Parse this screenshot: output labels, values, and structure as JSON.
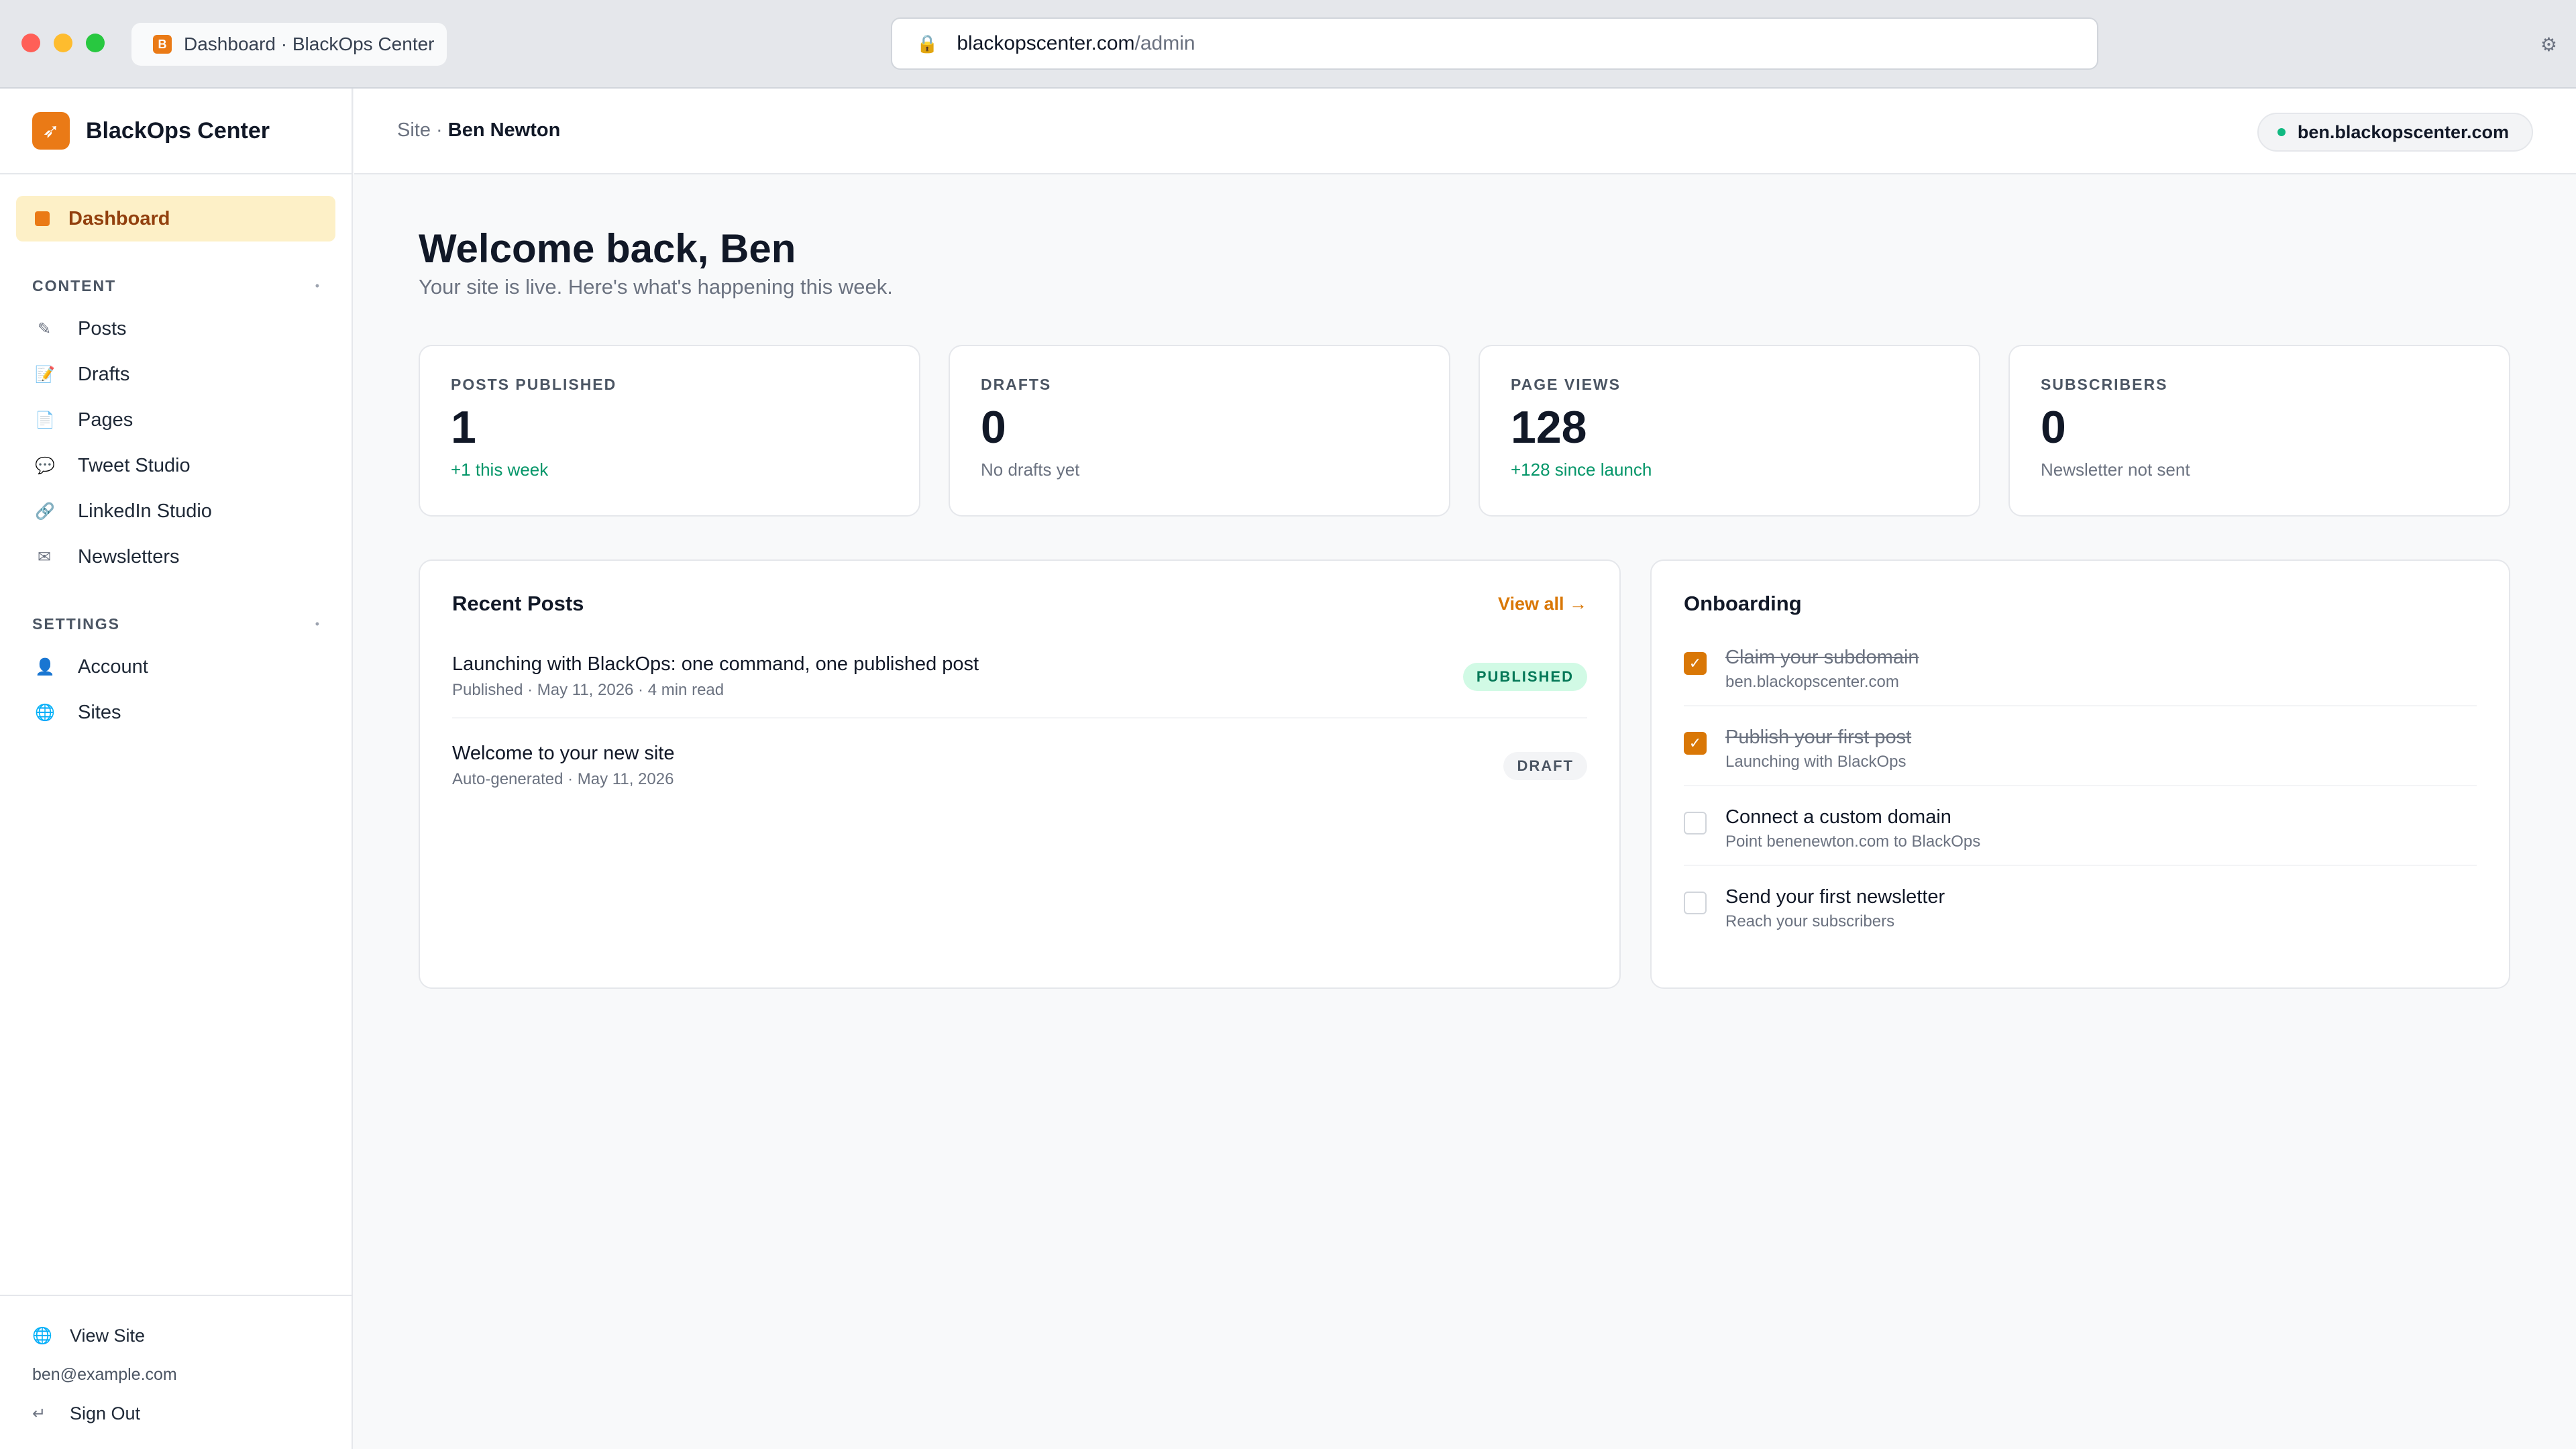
{
  "browser": {
    "tab_title": "Dashboard · BlackOps Center",
    "tab_favicon": "B",
    "url_host": "blackopscenter.com",
    "url_path": "/admin"
  },
  "sidebar": {
    "brand": "BlackOps Center",
    "active_item": "Dashboard",
    "sections": [
      {
        "title": "CONTENT",
        "items": [
          {
            "label": "Posts",
            "icon": "pencil-icon"
          },
          {
            "label": "Drafts",
            "icon": "memo-icon"
          },
          {
            "label": "Pages",
            "icon": "page-icon"
          },
          {
            "label": "Tweet Studio",
            "icon": "speech-bubble-icon"
          },
          {
            "label": "LinkedIn Studio",
            "icon": "link-icon"
          },
          {
            "label": "Newsletters",
            "icon": "envelope-icon"
          }
        ]
      },
      {
        "title": "SETTINGS",
        "items": [
          {
            "label": "Account",
            "icon": "user-icon"
          },
          {
            "label": "Sites",
            "icon": "globe-icon"
          }
        ]
      }
    ],
    "footer": {
      "view_site": "View Site",
      "email": "ben@example.com",
      "sign_out": "Sign Out"
    }
  },
  "topbar": {
    "crumb_prefix": "Site ·",
    "crumb_current": "Ben Newton",
    "site_domain": "ben.blackopscenter.com",
    "status_color": "#10b981"
  },
  "main": {
    "heading": "Welcome back, Ben",
    "subtitle": "Your site is live. Here's what's happening this week.",
    "stats": [
      {
        "label": "POSTS PUBLISHED",
        "value": "1",
        "note": "+1 this week",
        "positive": true
      },
      {
        "label": "DRAFTS",
        "value": "0",
        "note": "No drafts yet",
        "positive": false
      },
      {
        "label": "PAGE VIEWS",
        "value": "128",
        "note": "+128 since launch",
        "positive": true
      },
      {
        "label": "SUBSCRIBERS",
        "value": "0",
        "note": "Newsletter not sent",
        "positive": false
      }
    ],
    "recent_posts": {
      "title": "Recent Posts",
      "view_all": "View all →",
      "posts": [
        {
          "title": "Launching with BlackOps: one command, one published post",
          "meta": "Published · May 11, 2026 · 4 min read",
          "status": "PUBLISHED"
        },
        {
          "title": "Welcome to your new site",
          "meta": "Auto-generated · May 11, 2026",
          "status": "DRAFT"
        }
      ]
    },
    "onboarding": {
      "title": "Onboarding",
      "items": [
        {
          "title": "Claim your subdomain",
          "sub": "ben.blackopscenter.com",
          "done": true
        },
        {
          "title": "Publish your first post",
          "sub": "Launching with BlackOps",
          "done": true
        },
        {
          "title": "Connect a custom domain",
          "sub": "Point benenewton.com to BlackOps",
          "done": false
        },
        {
          "title": "Send your first newsletter",
          "sub": "Reach your subscribers",
          "done": false
        }
      ]
    }
  },
  "colors": {
    "accent": "#ea7a16",
    "accent_text": "#d97706",
    "active_bg": "#fdf0c7",
    "success": "#059669"
  }
}
